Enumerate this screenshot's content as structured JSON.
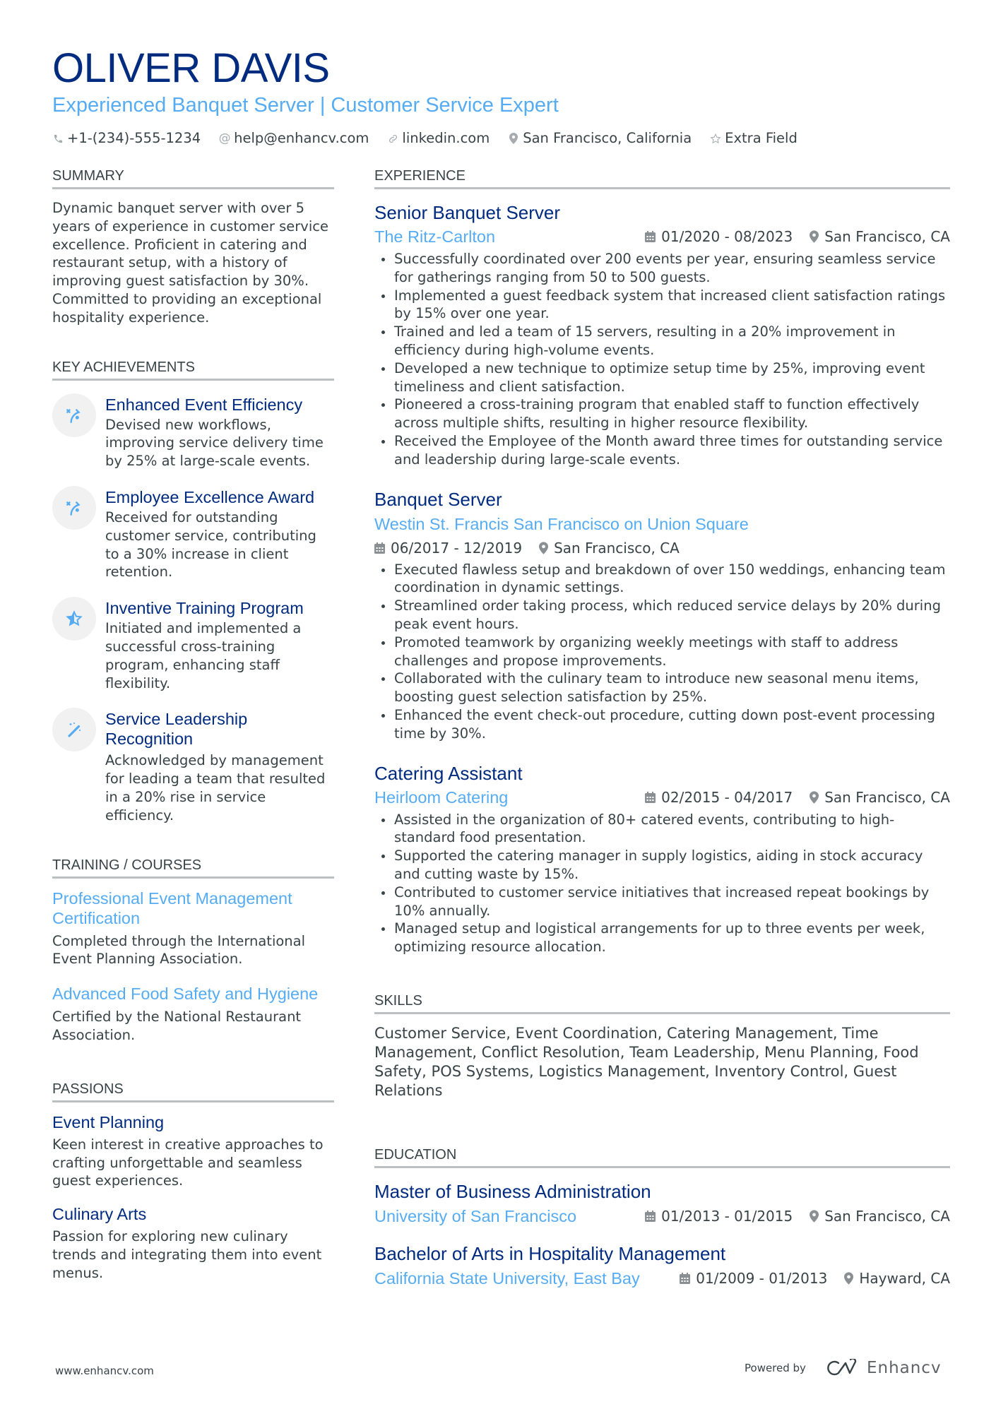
{
  "header": {
    "name": "OLIVER DAVIS",
    "headline": "Experienced Banquet Server | Customer Service Expert",
    "contacts": [
      {
        "icon": "phone-icon",
        "text": "+1-(234)-555-1234"
      },
      {
        "icon": "at-icon",
        "text": "help@enhancv.com"
      },
      {
        "icon": "link-icon",
        "text": "linkedin.com"
      },
      {
        "icon": "location-pin-icon",
        "text": "San Francisco, California"
      },
      {
        "icon": "star-icon",
        "text": "Extra Field"
      }
    ]
  },
  "summary": {
    "title": "SUMMARY",
    "text": "Dynamic banquet server with over 5 years of experience in customer service excellence. Proficient in catering and restaurant setup, with a history of improving guest satisfaction by 30%. Committed to providing an exceptional hospitality experience."
  },
  "achievements": {
    "title": "KEY ACHIEVEMENTS",
    "items": [
      {
        "icon": "strategy-icon",
        "title": "Enhanced Event Efficiency",
        "text": "Devised new workflows, improving service delivery time by 25% at large-scale events."
      },
      {
        "icon": "strategy-icon",
        "title": "Employee Excellence Award",
        "text": "Received for outstanding customer service, contributing to a 30% increase in client retention."
      },
      {
        "icon": "star-half-icon",
        "title": "Inventive Training Program",
        "text": "Initiated and implemented a successful cross-training program, enhancing staff flexibility."
      },
      {
        "icon": "magic-wand-icon",
        "title": "Service Leadership Recognition",
        "text": "Acknowledged by management for leading a team that resulted in a 20% rise in service efficiency."
      }
    ]
  },
  "training": {
    "title": "TRAINING / COURSES",
    "items": [
      {
        "title": "Professional Event Management Certification",
        "text": "Completed through the International Event Planning Association."
      },
      {
        "title": "Advanced Food Safety and Hygiene",
        "text": "Certified by the National Restaurant Association."
      }
    ]
  },
  "passions": {
    "title": "PASSIONS",
    "items": [
      {
        "title": "Event Planning",
        "text": "Keen interest in creative approaches to crafting unforgettable and seamless guest experiences."
      },
      {
        "title": "Culinary Arts",
        "text": "Passion for exploring new culinary trends and integrating them into event menus."
      }
    ]
  },
  "experience": {
    "title": "EXPERIENCE",
    "jobs": [
      {
        "title": "Senior Banquet Server",
        "company": "The Ritz-Carlton",
        "dates": "01/2020 - 08/2023",
        "location": "San Francisco, CA",
        "bullets": [
          "Successfully coordinated over 200 events per year, ensuring seamless service for gatherings ranging from 50 to 500 guests.",
          "Implemented a guest feedback system that increased client satisfaction ratings by 15% over one year.",
          "Trained and led a team of 15 servers, resulting in a 20% improvement in efficiency during high-volume events.",
          "Developed a new technique to optimize setup time by 25%, improving event timeliness and client satisfaction.",
          "Pioneered a cross-training program that enabled staff to function effectively across multiple shifts, resulting in higher resource flexibility.",
          "Received the Employee of the Month award three times for outstanding service and leadership during large-scale events."
        ]
      },
      {
        "title": "Banquet Server",
        "company": "Westin St. Francis San Francisco on Union Square",
        "dates": "06/2017 - 12/2019",
        "location": "San Francisco, CA",
        "bullets": [
          "Executed flawless setup and breakdown of over 150 weddings, enhancing team coordination in dynamic settings.",
          "Streamlined order taking process, which reduced service delays by 20% during peak event hours.",
          "Promoted teamwork by organizing weekly meetings with staff to address challenges and propose improvements.",
          "Collaborated with the culinary team to introduce new seasonal menu items, boosting guest selection satisfaction by 25%.",
          "Enhanced the event check-out procedure, cutting down post-event processing time by 30%."
        ]
      },
      {
        "title": "Catering Assistant",
        "company": "Heirloom Catering",
        "dates": "02/2015 - 04/2017",
        "location": "San Francisco, CA",
        "bullets": [
          "Assisted in the organization of 80+ catered events, contributing to high-standard food presentation.",
          "Supported the catering manager in supply logistics, aiding in stock accuracy and cutting waste by 15%.",
          "Contributed to customer service initiatives that increased repeat bookings by 10% annually.",
          "Managed setup and logistical arrangements for up to three events per week, optimizing resource allocation."
        ]
      }
    ]
  },
  "skills": {
    "title": "SKILLS",
    "text": "Customer Service, Event Coordination, Catering Management, Time Management, Conflict Resolution, Team Leadership, Menu Planning, Food Safety, POS Systems, Logistics Management, Inventory Control, Guest Relations"
  },
  "education": {
    "title": "EDUCATION",
    "items": [
      {
        "degree": "Master of Business Administration",
        "school": "University of San Francisco",
        "dates": "01/2013 - 01/2015",
        "location": "San Francisco, CA"
      },
      {
        "degree": "Bachelor of Arts in Hospitality Management",
        "school": "California State University, East Bay",
        "dates": "01/2009 - 01/2013",
        "location": "Hayward, CA"
      }
    ]
  },
  "footer": {
    "website": "www.enhancv.com",
    "powered_by": "Powered by",
    "brand": "Enhancv"
  },
  "colors": {
    "name": "#002b7f",
    "accent": "#56acf2",
    "text": "#384347",
    "rule": "#bdc0c3",
    "icon_bg": "#f1f1f1"
  }
}
